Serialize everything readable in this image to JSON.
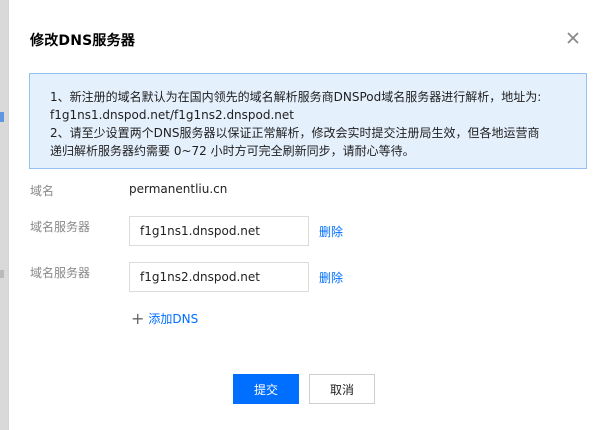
{
  "dialog": {
    "title": "修改DNS服务器"
  },
  "notice": {
    "line1": "1、新注册的域名默认为在国内领先的域名解析服务商DNSPod域名服务器进行解析，地址为:",
    "line2": "f1g1ns1.dnspod.net/f1g1ns2.dnspod.net",
    "line3": "2、请至少设置两个DNS服务器以保证正常解析，修改会实时提交注册局生效，但各地运营商",
    "line4": "递归解析服务器约需要 0~72 小时方可完全刷新同步，请耐心等待。"
  },
  "form": {
    "domain_label": "域名",
    "domain_value": "permanentliu.cn",
    "nameservers": [
      {
        "label": "域名服务器",
        "value": "f1g1ns1.dnspod.net",
        "delete_label": "删除"
      },
      {
        "label": "域名服务器",
        "value": "f1g1ns2.dnspod.net",
        "delete_label": "删除"
      }
    ],
    "add_label": "添加DNS"
  },
  "footer": {
    "submit_label": "提交",
    "cancel_label": "取消"
  },
  "icons": {
    "close": "close-icon",
    "add": "plus-icon"
  },
  "colors": {
    "accent": "#006eff",
    "notice_bg": "#e5f0fd",
    "notice_border": "#97c1f2"
  }
}
